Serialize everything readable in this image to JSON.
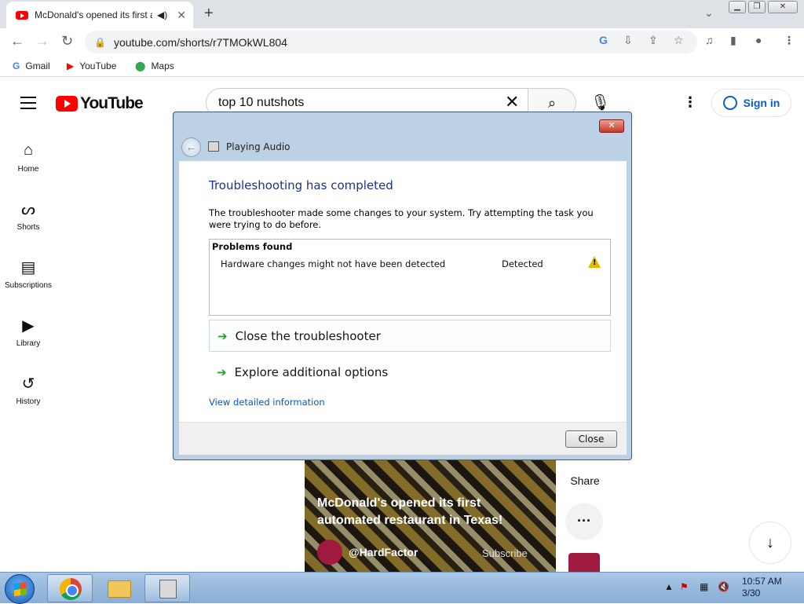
{
  "browser": {
    "tab_title": "McDonald's opened its first a",
    "url": "youtube.com/shorts/r7TMOkWL804",
    "bookmarks": [
      {
        "label": "Gmail",
        "icon": "gmail-icon"
      },
      {
        "label": "YouTube",
        "icon": "youtube-icon"
      },
      {
        "label": "Maps",
        "icon": "maps-icon"
      }
    ]
  },
  "youtube": {
    "logo_text": "YouTube",
    "search_value": "top 10 nutshots",
    "signin_label": "Sign in",
    "nav": [
      {
        "label": "Home",
        "icon": "home-icon"
      },
      {
        "label": "Shorts",
        "icon": "shorts-icon"
      },
      {
        "label": "Subscriptions",
        "icon": "subscriptions-icon"
      },
      {
        "label": "Library",
        "icon": "library-icon"
      },
      {
        "label": "History",
        "icon": "history-icon"
      }
    ],
    "short": {
      "title": "McDonald's opened its first automated restaurant in Texas!",
      "channel": "@HardFactor",
      "subscribe": "Subscribe"
    },
    "share_label": "Share"
  },
  "dialog": {
    "window_title": "Playing Audio",
    "heading": "Troubleshooting has completed",
    "description": "The troubleshooter made some changes to your system. Try attempting the task you were trying to do before.",
    "problems_header": "Problems found",
    "problems": [
      {
        "name": "Hardware changes might not have been detected",
        "status": "Detected"
      }
    ],
    "options": [
      {
        "label": "Close the troubleshooter"
      },
      {
        "label": "Explore additional options"
      }
    ],
    "details_link": "View detailed information",
    "close_button": "Close"
  },
  "taskbar": {
    "time": "10:57 AM",
    "date": "3/30"
  }
}
